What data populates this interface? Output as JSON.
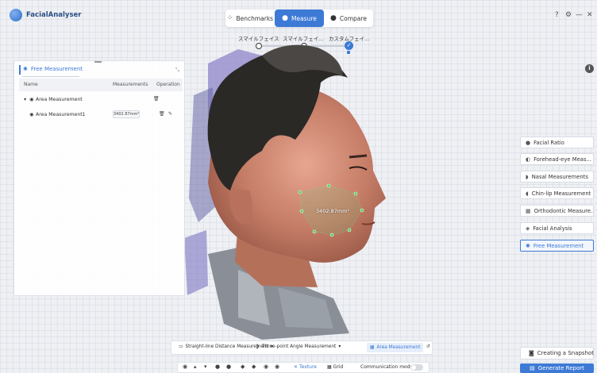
{
  "app": {
    "title": "FacialAnalyser"
  },
  "modes": [
    {
      "label": "Benchmarks",
      "icon": "benchmarks-icon"
    },
    {
      "label": "Measure",
      "icon": "measure-icon",
      "active": true
    },
    {
      "label": "Compare",
      "icon": "compare-icon"
    }
  ],
  "window_controls": {
    "help": "?",
    "settings": "⚙",
    "minimize": "—",
    "close": "✕"
  },
  "expressions": [
    "スマイルフェイス",
    "スマイルフェイ...",
    "カスタムフェイ..."
  ],
  "panel": {
    "title": "Free Measurement",
    "columns": {
      "name": "Name",
      "measurements": "Measurements",
      "operation": "Operation"
    },
    "group_label": "Area Measurement",
    "item_label": "Area Measurement1",
    "item_value": "3402.87mm²"
  },
  "overlay": {
    "measurement_label": "3402.87mm²"
  },
  "side_buttons": [
    {
      "label": "Facial Ratio",
      "icon": "face-icon"
    },
    {
      "label": "Forehead-eye Meas...",
      "icon": "forehead-icon"
    },
    {
      "label": "Nasal Measurements",
      "icon": "nose-icon"
    },
    {
      "label": "Chin-lip Measurement",
      "icon": "chin-icon"
    },
    {
      "label": "Orthodontic Measure...",
      "icon": "orthodontic-icon"
    },
    {
      "label": "Facial Analysis",
      "icon": "analysis-icon"
    },
    {
      "label": "Free Measurement",
      "icon": "free-measure-icon",
      "active": true
    }
  ],
  "actions": {
    "snapshot": "Creating a Snapshot",
    "report": "Generate Report"
  },
  "measure_tools": {
    "straight": "Straight-line Distance Measurement",
    "angle": "Three-point Angle Measurement",
    "area": "Area Measurement"
  },
  "view_bar": {
    "texture": "Texture",
    "grid": "Grid",
    "communication": "Communication mode"
  },
  "colors": {
    "accent": "#3d7ad6",
    "measure_points": "#4fd15a"
  }
}
